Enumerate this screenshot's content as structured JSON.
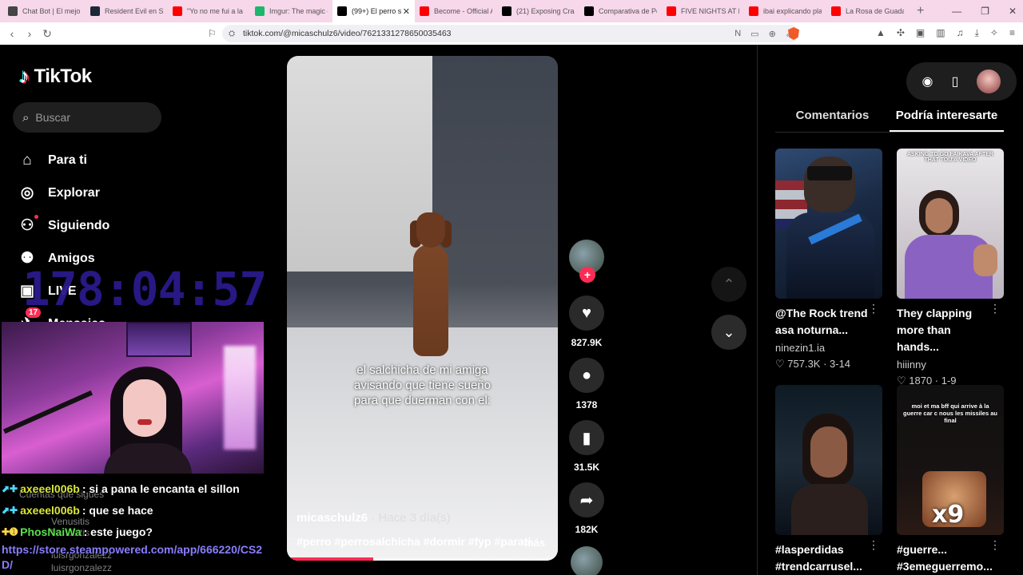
{
  "browser": {
    "tabs": [
      {
        "label": "Chat Bot | El mejor",
        "color": "#444444",
        "active": false
      },
      {
        "label": "Resident Evil en Ste",
        "color": "#1b2838",
        "active": false
      },
      {
        "label": "\"Yo no me fui a la B",
        "color": "#ff0000",
        "active": false
      },
      {
        "label": "Imgur: The magic o",
        "color": "#1bb76e",
        "active": false
      },
      {
        "label": "(99+) El perro s",
        "color": "#000000",
        "active": true
      },
      {
        "label": "Become - Official A",
        "color": "#ff0000",
        "active": false
      },
      {
        "label": "(21) Exposing Crazy",
        "color": "#000000",
        "active": false
      },
      {
        "label": "Comparativa de Pe",
        "color": "#000000",
        "active": false
      },
      {
        "label": "FIVE NIGHTS AT FRE",
        "color": "#ff0000",
        "active": false
      },
      {
        "label": "ibai explicando plan",
        "color": "#ff0000",
        "active": false
      },
      {
        "label": "La Rosa de Guadalu",
        "color": "#ff0000",
        "active": false
      }
    ],
    "url": "tiktok.com/@micaschulz6/video/7621331278650035463"
  },
  "sidebar": {
    "logo": "TikTok",
    "search_placeholder": "Buscar",
    "nav": [
      {
        "label": "Para ti",
        "icon": "home-icon",
        "glyph": "⌂"
      },
      {
        "label": "Explorar",
        "icon": "compass-icon",
        "glyph": "◎"
      },
      {
        "label": "Siguiendo",
        "icon": "following-icon",
        "glyph": "⚇"
      },
      {
        "label": "Amigos",
        "icon": "friends-icon",
        "glyph": "⚉"
      },
      {
        "label": "LIVE",
        "icon": "live-icon",
        "glyph": "▣"
      },
      {
        "label": "Mensajes",
        "icon": "messages-icon",
        "glyph": "✈"
      }
    ],
    "messages_badge": "17",
    "following_accounts_label": "Cuentas que sigues",
    "ghost_users": [
      "Venusitis",
      "Venusitis",
      "luisrgonzalezz",
      "luisrgonzalezz"
    ]
  },
  "overlay": {
    "timer": "178:04:57",
    "chat": [
      {
        "user": "axeeel006b",
        "message": ": si a pana le encanta el sillon",
        "badge": "⬈✚"
      },
      {
        "user": "axeeel006b",
        "message": ": que se hace",
        "badge": "⬈✚"
      },
      {
        "user": "PhosNaiWa",
        "message": ": este juego?",
        "badge": "✚➊"
      }
    ],
    "link": "https://store.steampowered.com/app/666220/CS2D/"
  },
  "video": {
    "caption": "el salchicha de mi amiga avisando que tiene sueño para que duerman con el:",
    "author": "micaschulz6",
    "time": "· Hace 3 día(s)",
    "tags": "#perro #perrosalchicha #dormir #fyp #parati",
    "more": "más",
    "progress": 0.32
  },
  "actions": {
    "likes": "827.9K",
    "comments": "1378",
    "saves": "31.5K",
    "shares": "182K"
  },
  "right": {
    "tabs": [
      "Comentarios",
      "Podría interesarte"
    ],
    "cards": [
      {
        "title": "@The Rock trend asa noturna...",
        "user": "ninezin1.ia",
        "stats": "♡ 757.3K · 3-14",
        "thumb_caption": "",
        "thumb_big": ""
      },
      {
        "title": "They clapping more than hands...",
        "user": "hiiinny",
        "stats": "♡ 1870 · 1-9",
        "thumb_caption": "ASKING TO GO FAIKAVA AFTER THAT TOU'A VIDEO",
        "thumb_big": ""
      },
      {
        "title": "#lasperdidas #trendcarrusel...",
        "user": "",
        "stats": "",
        "thumb_caption": "",
        "thumb_big": ""
      },
      {
        "title": "#guerre... #3emeguerremo...",
        "user": "",
        "stats": "",
        "thumb_caption": "moi et ma bff qui arrive à la guerre car c nous les missiles au final",
        "thumb_big": "x9"
      }
    ]
  }
}
